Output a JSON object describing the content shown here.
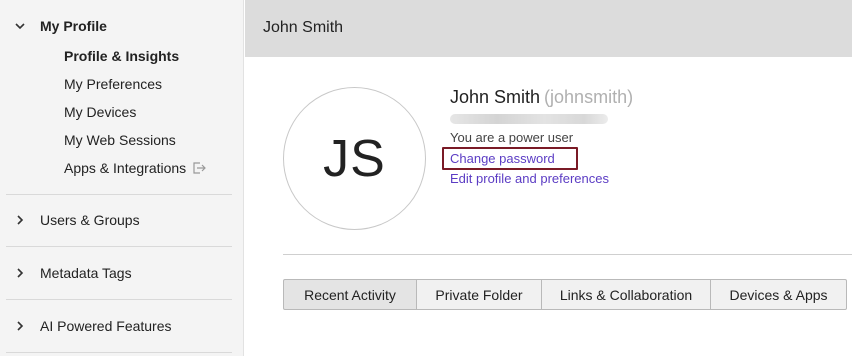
{
  "sidebar": {
    "my_profile": {
      "label": "My Profile",
      "expanded": true,
      "icon": "chevron-down-icon",
      "items": [
        {
          "label": "Profile & Insights",
          "active": true
        },
        {
          "label": "My Preferences"
        },
        {
          "label": "My Devices"
        },
        {
          "label": "My Web Sessions"
        },
        {
          "label": "Apps & Integrations",
          "icon": "external-link-icon"
        }
      ]
    },
    "sections": [
      {
        "label": "Users & Groups",
        "icon": "chevron-right-icon"
      },
      {
        "label": "Metadata Tags",
        "icon": "chevron-right-icon"
      },
      {
        "label": "AI Powered Features",
        "icon": "chevron-right-icon"
      }
    ]
  },
  "header": {
    "title": "John Smith"
  },
  "profile": {
    "initials": "JS",
    "name": "John Smith",
    "username": "(johnsmith)",
    "role": "You are a power user",
    "change_password": "Change password",
    "edit_profile": "Edit profile and preferences"
  },
  "tabs": [
    {
      "label": "Recent Activity",
      "selected": true
    },
    {
      "label": "Private Folder"
    },
    {
      "label": "Links & Collaboration"
    },
    {
      "label": "Devices & Apps"
    }
  ],
  "colors": {
    "link": "#5b3cc4",
    "highlight_border": "#7a1a26",
    "sidebar_bg": "#f4f4f4",
    "header_bg": "#dcdcdc"
  }
}
